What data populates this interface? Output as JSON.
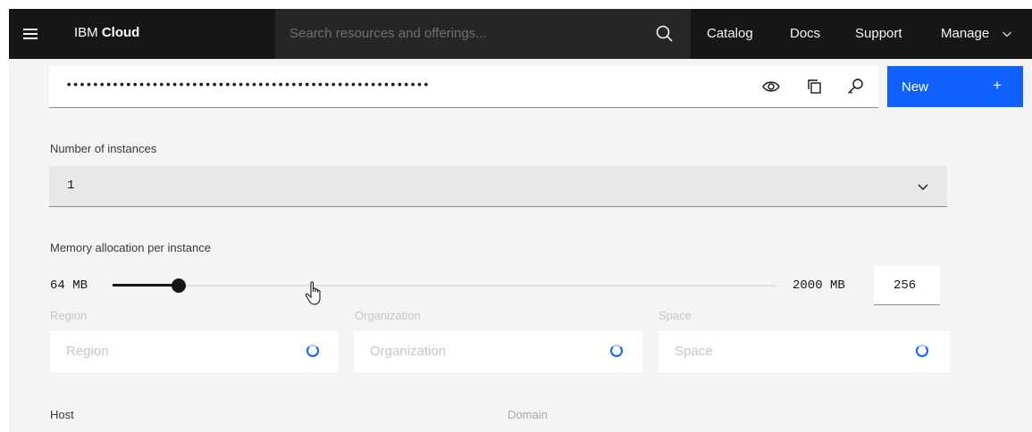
{
  "header": {
    "brand_prefix": "IBM",
    "brand_name": "Cloud",
    "search_placeholder": "Search resources and offerings...",
    "nav": {
      "catalog": "Catalog",
      "docs": "Docs",
      "support": "Support",
      "manage": "Manage"
    }
  },
  "credentials": {
    "password_masked": "•••••••••••••••••••••••••••••••••••••••••••••••••••••••",
    "icons": [
      "eye-icon",
      "copy-icon",
      "key-icon"
    ],
    "new_button_label": "New",
    "new_button_plus": "+"
  },
  "instances": {
    "label": "Number of instances",
    "value": "1"
  },
  "memory": {
    "label": "Memory allocation per instance",
    "min_label": "64 MB",
    "max_label": "2000 MB",
    "value": "256",
    "slider_fraction": 0.1
  },
  "region": {
    "label": "Region",
    "placeholder": "Region"
  },
  "organization": {
    "label": "Organization",
    "placeholder": "Organization"
  },
  "space": {
    "label": "Space",
    "placeholder": "Space"
  },
  "host": {
    "label": "Host"
  },
  "domain": {
    "label": "Domain"
  },
  "colors": {
    "header_bg": "#161616",
    "primary_blue": "#0f62fe",
    "page_bg": "#f4f4f4"
  }
}
